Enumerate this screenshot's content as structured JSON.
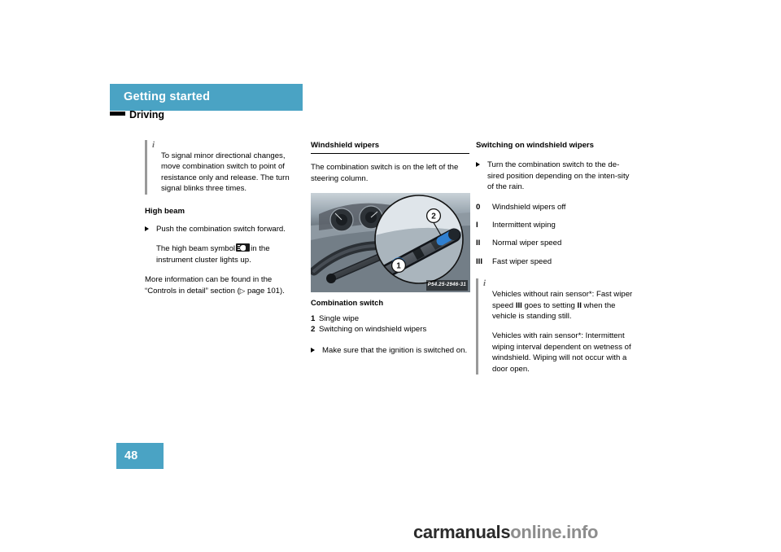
{
  "header": {
    "title": "Getting started",
    "subtitle": "Driving",
    "page_number": "48"
  },
  "column1": {
    "note": {
      "icon": "i",
      "text": "To signal minor directional changes, move combination switch to point of resistance only and release. The turn signal blinks three times."
    },
    "high_beam_heading": "High beam",
    "bullet1": "Push the combination switch forward.",
    "bullet1_sub_pre": "The high beam symbol",
    "bullet1_sub_post": "in the instrument cluster lights up.",
    "more_info": "More information can be found in the “Controls in detail” section (",
    "more_info_ref": "page 101).",
    "ref_arrow": "▷"
  },
  "column2": {
    "heading": "Windshield wipers",
    "intro": "The combination switch is on the left of the steering column.",
    "figure_code": "P54.25-2946-31",
    "figure_callouts": [
      "1",
      "2"
    ],
    "combination_switch_heading": "Combination switch",
    "items": [
      {
        "num": "1",
        "label": "Single wipe"
      },
      {
        "num": "2",
        "label": "Switching on windshield wipers"
      }
    ],
    "bullet": "Make sure that the ignition is switched on."
  },
  "column3": {
    "heading": "Switching on windshield wipers",
    "bullet": "Turn the combination switch to the de-sired position depending on the inten-sity of the rain.",
    "settings": [
      {
        "term": "0",
        "desc": "Windshield wipers off"
      },
      {
        "term": "I",
        "desc": "Intermittent wiping"
      },
      {
        "term": "II",
        "desc": "Normal wiper speed"
      },
      {
        "term": "III",
        "desc": "Fast wiper speed"
      }
    ],
    "note": {
      "icon": "i",
      "para1_a": "Vehicles without rain sensor",
      "para1_b": ": Fast wiper speed ",
      "para1_c": "III",
      "para1_d": " goes to setting ",
      "para1_e": "II",
      "para1_f": " when the vehicle is standing still.",
      "para2_a": "Vehicles with rain sensor",
      "para2_b": ": Intermittent wiping interval dependent on wetness of windshield. Wiping will not occur with a door open.",
      "asterisk": "*"
    }
  },
  "watermark": {
    "text_dark": "carmanuals",
    "text_light": "online.info"
  },
  "colors": {
    "accent": "#4aa3c4",
    "note_bar": "#9a9a9a",
    "text": "#000000"
  }
}
